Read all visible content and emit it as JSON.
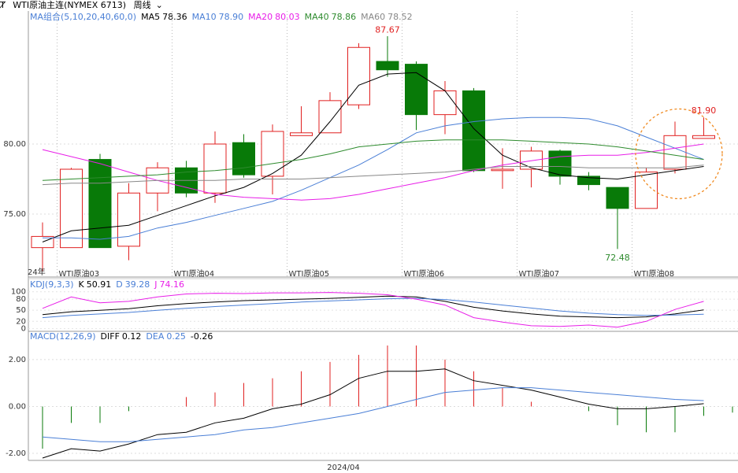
{
  "header": {
    "nav_icon": "Ⱦ",
    "symbol_label": "WTI原油主连(NYMEX 6713)",
    "period_label": "周线"
  },
  "legends": {
    "ma": {
      "group": "MA组合(5,10,20,40,60,0)",
      "items": [
        {
          "label": "MA5",
          "value": "78.36",
          "color": "#000000"
        },
        {
          "label": "MA10",
          "value": "78.90",
          "color": "#4a7fd6"
        },
        {
          "label": "MA20",
          "value": "80.03",
          "color": "#e81ee8"
        },
        {
          "label": "MA40",
          "value": "78.86",
          "color": "#2e8b2e"
        },
        {
          "label": "MA60",
          "value": "78.52",
          "color": "#888888"
        }
      ]
    },
    "kdj": {
      "group": "KDJ(9,3,3)",
      "items": [
        {
          "label": "K",
          "value": "50.91",
          "color": "#000000"
        },
        {
          "label": "D",
          "value": "39.28",
          "color": "#4a7fd6"
        },
        {
          "label": "J",
          "value": "74.16",
          "color": "#e81ee8"
        }
      ]
    },
    "macd": {
      "group": "MACD(12,26,9)",
      "items": [
        {
          "label": "DIFF",
          "value": "0.12",
          "color": "#000000"
        },
        {
          "label": "DEA",
          "value": "0.25",
          "color": "#4a7fd6"
        },
        {
          "label": "",
          "value": "-0.26",
          "color": "#000000"
        }
      ]
    }
  },
  "bottom_label": "2024/04",
  "year_label": "24年",
  "chart_data": [
    {
      "type": "candlestick",
      "panel": "price",
      "y_ticks": [
        "80.00",
        "75.00"
      ],
      "y_range": [
        70.5,
        89.5
      ],
      "x_labels": [
        "WTI原油03",
        "WTI原油04",
        "WTI原油05",
        "WTI原油06",
        "WTI原油07",
        "WTI原油08"
      ],
      "annotations": [
        {
          "text": "87.67",
          "index": 12,
          "value": 87.67,
          "color": "#e02020",
          "position": "above"
        },
        {
          "text": "72.48",
          "index": 20,
          "value": 72.48,
          "color": "#2e8b2e",
          "position": "below"
        },
        {
          "text": "81.90",
          "index": 23,
          "value": 81.9,
          "color": "#e02020",
          "position": "above"
        }
      ],
      "candles": [
        {
          "o": 72.6,
          "h": 74.4,
          "l": 70.9,
          "c": 73.4
        },
        {
          "o": 72.6,
          "h": 78.3,
          "l": 72.6,
          "c": 78.2
        },
        {
          "o": 78.9,
          "h": 79.3,
          "l": 72.6,
          "c": 72.6
        },
        {
          "o": 72.7,
          "h": 77.2,
          "l": 71.7,
          "c": 76.5
        },
        {
          "o": 76.5,
          "h": 78.7,
          "l": 75.2,
          "c": 78.3
        },
        {
          "o": 78.3,
          "h": 78.8,
          "l": 76.2,
          "c": 76.5
        },
        {
          "o": 76.5,
          "h": 80.9,
          "l": 75.8,
          "c": 80.0
        },
        {
          "o": 80.1,
          "h": 80.7,
          "l": 77.6,
          "c": 77.8
        },
        {
          "o": 77.7,
          "h": 81.4,
          "l": 76.4,
          "c": 80.9
        },
        {
          "o": 80.6,
          "h": 82.7,
          "l": 80.6,
          "c": 80.8
        },
        {
          "o": 80.8,
          "h": 83.7,
          "l": 80.8,
          "c": 83.1
        },
        {
          "o": 82.8,
          "h": 87.2,
          "l": 82.5,
          "c": 86.9
        },
        {
          "o": 85.9,
          "h": 87.7,
          "l": 84.8,
          "c": 85.3
        },
        {
          "o": 85.7,
          "h": 85.9,
          "l": 81.0,
          "c": 82.1
        },
        {
          "o": 82.1,
          "h": 84.5,
          "l": 80.7,
          "c": 83.8
        },
        {
          "o": 83.8,
          "h": 84.0,
          "l": 78.0,
          "c": 78.1
        },
        {
          "o": 78.1,
          "h": 79.7,
          "l": 76.8,
          "c": 78.2
        },
        {
          "o": 78.2,
          "h": 79.8,
          "l": 76.9,
          "c": 79.5
        },
        {
          "o": 79.5,
          "h": 79.6,
          "l": 77.1,
          "c": 77.7
        },
        {
          "o": 77.7,
          "h": 78.0,
          "l": 76.7,
          "c": 77.1
        },
        {
          "o": 76.9,
          "h": 76.9,
          "l": 72.5,
          "c": 75.4
        },
        {
          "o": 75.4,
          "h": 78.3,
          "l": 75.4,
          "c": 78.0
        },
        {
          "o": 78.2,
          "h": 81.6,
          "l": 77.9,
          "c": 80.6
        },
        {
          "o": 80.4,
          "h": 81.9,
          "l": 80.4,
          "c": 80.6
        }
      ],
      "series": [
        {
          "name": "MA5",
          "color": "#000000",
          "values": [
            73.0,
            73.8,
            74.0,
            74.2,
            74.9,
            75.6,
            76.3,
            76.9,
            77.9,
            79.2,
            81.6,
            84.2,
            85.0,
            85.1,
            83.8,
            81.1,
            79.2,
            78.3,
            77.8,
            77.6,
            77.5,
            77.8,
            78.1,
            78.4
          ]
        },
        {
          "name": "MA10",
          "color": "#4a7fd6",
          "values": [
            73.3,
            73.3,
            73.2,
            73.4,
            74.0,
            74.4,
            74.9,
            75.4,
            75.9,
            76.7,
            77.6,
            78.5,
            79.6,
            80.8,
            81.3,
            81.6,
            81.8,
            81.9,
            81.9,
            81.8,
            81.3,
            80.5,
            79.7,
            78.9
          ]
        },
        {
          "name": "MA20",
          "color": "#e81ee8",
          "values": [
            79.6,
            79.1,
            78.6,
            78.0,
            77.4,
            76.9,
            76.4,
            76.2,
            76.1,
            76.0,
            76.1,
            76.4,
            76.8,
            77.2,
            77.6,
            78.1,
            78.5,
            78.8,
            79.1,
            79.2,
            79.2,
            79.4,
            79.7,
            80.0
          ]
        },
        {
          "name": "MA40",
          "color": "#2e8b2e",
          "values": [
            77.4,
            77.5,
            77.6,
            77.7,
            77.8,
            78.0,
            78.1,
            78.3,
            78.6,
            78.9,
            79.3,
            79.8,
            80.0,
            80.2,
            80.3,
            80.3,
            80.3,
            80.2,
            80.1,
            80.0,
            79.8,
            79.5,
            79.2,
            78.9
          ]
        },
        {
          "name": "MA60",
          "color": "#888888",
          "values": [
            77.1,
            77.2,
            77.2,
            77.3,
            77.4,
            77.4,
            77.4,
            77.5,
            77.5,
            77.5,
            77.6,
            77.7,
            77.8,
            77.9,
            78.0,
            78.2,
            78.4,
            78.4,
            78.4,
            78.3,
            78.3,
            78.3,
            78.3,
            78.5
          ]
        }
      ]
    },
    {
      "type": "line",
      "panel": "kdj",
      "y_ticks": [
        "100",
        "80",
        "50",
        "20",
        "0"
      ],
      "y_range": [
        -5,
        110
      ],
      "series": [
        {
          "name": "K",
          "color": "#000000",
          "values": [
            38,
            46,
            50,
            54,
            62,
            68,
            72,
            76,
            78,
            80,
            82,
            85,
            88,
            86,
            74,
            58,
            48,
            40,
            34,
            32,
            30,
            32,
            40,
            51
          ]
        },
        {
          "name": "D",
          "color": "#4a7fd6",
          "values": [
            30,
            36,
            40,
            44,
            50,
            55,
            60,
            64,
            68,
            72,
            75,
            78,
            81,
            82,
            79,
            72,
            64,
            56,
            48,
            42,
            38,
            36,
            37,
            39
          ]
        },
        {
          "name": "J",
          "color": "#e81ee8",
          "values": [
            55,
            86,
            70,
            74,
            86,
            94,
            96,
            95,
            97,
            97,
            98,
            96,
            92,
            80,
            64,
            30,
            18,
            8,
            6,
            10,
            4,
            20,
            52,
            74
          ]
        }
      ]
    },
    {
      "type": "bar+line",
      "panel": "macd",
      "y_ticks": [
        "2.00",
        "0.00",
        "-2.00"
      ],
      "y_range": [
        -2.3,
        2.8
      ],
      "histogram": [
        -1.8,
        -0.7,
        -0.7,
        -0.2,
        0.0,
        0.4,
        0.6,
        1.0,
        1.2,
        1.5,
        1.9,
        2.2,
        2.6,
        2.6,
        2.0,
        1.5,
        0.8,
        0.2,
        0.0,
        -0.2,
        -0.8,
        -1.1,
        -1.1,
        -0.4,
        -0.26
      ],
      "series": [
        {
          "name": "DIFF",
          "color": "#000000",
          "values": [
            -2.2,
            -1.8,
            -1.9,
            -1.6,
            -1.2,
            -1.1,
            -0.7,
            -0.5,
            -0.1,
            0.1,
            0.5,
            1.2,
            1.5,
            1.5,
            1.6,
            1.1,
            0.9,
            0.7,
            0.4,
            0.1,
            -0.1,
            -0.1,
            0.0,
            0.12
          ]
        },
        {
          "name": "DEA",
          "color": "#4a7fd6",
          "values": [
            -1.3,
            -1.4,
            -1.5,
            -1.5,
            -1.4,
            -1.3,
            -1.2,
            -1.0,
            -0.9,
            -0.7,
            -0.5,
            -0.3,
            0.0,
            0.3,
            0.6,
            0.7,
            0.8,
            0.8,
            0.7,
            0.6,
            0.5,
            0.4,
            0.3,
            0.25
          ]
        }
      ]
    }
  ]
}
